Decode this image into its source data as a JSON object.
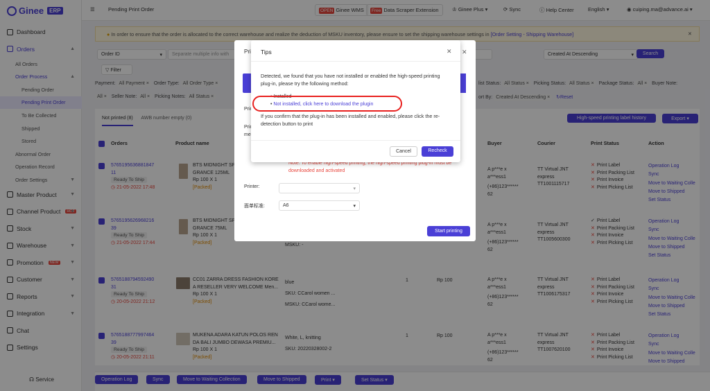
{
  "sidebar": {
    "logo": "Ginee",
    "badge": "ERP",
    "items": [
      {
        "label": "Dashboard"
      },
      {
        "label": "Orders"
      },
      {
        "label": "All Orders"
      },
      {
        "label": "Order Process"
      },
      {
        "label": "Pending Order"
      },
      {
        "label": "Pending Print Order"
      },
      {
        "label": "To Be Collected"
      },
      {
        "label": "Shipped"
      },
      {
        "label": "Stored"
      },
      {
        "label": "Abnormal Order"
      },
      {
        "label": "Operation Record"
      },
      {
        "label": "Order Settings"
      },
      {
        "label": "Master Product"
      },
      {
        "label": "Channel Product"
      },
      {
        "label": "Stock"
      },
      {
        "label": "Warehouse"
      },
      {
        "label": "Promotion"
      },
      {
        "label": "Customer"
      },
      {
        "label": "Reports"
      },
      {
        "label": "Integration"
      },
      {
        "label": "Chat"
      },
      {
        "label": "Settings"
      }
    ],
    "new_badge": "NEW",
    "service": "Service"
  },
  "topbar": {
    "page_title": "Pending Print Order",
    "open_tag": "OPEN",
    "wms": "Ginee WMS",
    "free_tag": "Free",
    "scraper": "Data Scraper Extension",
    "plus": "Ginee Plus",
    "sync": "Sync",
    "help": "Help Center",
    "lang": "English",
    "user": "cuiping.ma@advance.ai"
  },
  "notice": {
    "text": "In order to ensure that the order is allocated to the correct warehouse and realize the deduction of MSKU inventory, please ensure to set the shipping warehouse settings in",
    "link": "[Order Setting - Shipping Warehouse]"
  },
  "search": {
    "field": "Order ID",
    "placeholder": "Separate multiple info with",
    "sort": "Created At Descending",
    "button": "Search",
    "filter": "Filter"
  },
  "filters": {
    "payment_label": "Payment:",
    "payment_val": "All Payment",
    "order_type_label": "Order Type:",
    "order_type_val": "All Order Type",
    "all": "All",
    "seller_note": "Seller Note:",
    "picking_notes": "Picking Notes:",
    "list_status": "list Status:",
    "picking_status": "Picking Status:",
    "package_status": "Package Status:",
    "buyer_note": "Buyer Note:",
    "sort_by": "ort By:",
    "sort_val": "Created At Descending",
    "reset": "Reset"
  },
  "tabs": {
    "t1": "Not printed (8)",
    "t2": "AWB number empty (0)",
    "history": "High-speed printing label history",
    "export": "Export"
  },
  "table": {
    "headers": {
      "orders": "Orders",
      "product": "Product name",
      "buyer": "Buyer",
      "courier": "Courier",
      "print": "Print Status",
      "action": "Action"
    },
    "rows": [
      {
        "id1": "5765195636881847",
        "id2": "11",
        "tag": "Ready To Ship",
        "date": "21-05-2022 17:48",
        "p1": "BTS MIDNIGHT SP",
        "p2": "GRANCE 125ML",
        "p3": "Rp 100 X 1",
        "packed": "[Packed]",
        "b1": "A p***e x",
        "b2": "a***ess1",
        "b3": "(+86)123******",
        "b4": "62",
        "c1": "TT Virtual JNT",
        "c2": "express",
        "c3": "TT1001115717",
        "ps": [
          "Print Label",
          "Print Packing List",
          "Print Invoice",
          "Print Picking List"
        ],
        "acts": [
          "Operation Log",
          "Sync",
          "Move to Waiting Colle",
          "Move to Shipped",
          "Set Status"
        ]
      },
      {
        "id1": "5765195626968216",
        "id2": "39",
        "tag": "Ready To Ship",
        "date": "21-05-2022 17:44",
        "p1": "BTS MIDNIGHT SP",
        "p2": "GRANCE 75ML",
        "p3": "Rp 100 X 1",
        "packed": "[Packed]",
        "msku": "MSKU: -",
        "b1": "A p***e x",
        "b2": "a***ess1",
        "b3": "(+86)123******",
        "b4": "62",
        "c1": "TT Virtual JNT",
        "c2": "express",
        "c3": "TT1005600300",
        "ps": [
          "Print Label",
          "Print Packing List",
          "Print Invoice",
          "Print Picking List"
        ],
        "acts": [
          "Operation Log",
          "Sync",
          "Move to Waiting Colle",
          "Move to Shipped",
          "Set Status"
        ]
      },
      {
        "id1": "5765188794592490",
        "id2": "31",
        "tag": "Ready To Ship",
        "date": "20-05-2022 21:12",
        "p1": "CC01 ZARRA DRESS FASHION KORE",
        "p2": "A RESELLER VERY WELCOME Men...",
        "p3": "Rp 100 X 1",
        "packed": "[Packed]",
        "var": "blue",
        "sku": "SKU: CCarol women ...",
        "msku": "MSKU: CCarol wome...",
        "qty": "1",
        "price": "Rp 100",
        "b1": "A p***e x",
        "b2": "a***ess1",
        "b3": "(+86)123******",
        "b4": "62",
        "c1": "TT Virtual JNT",
        "c2": "express",
        "c3": "TT1006175317",
        "ps": [
          "Print Label",
          "Print Packing List",
          "Print Invoice",
          "Print Picking List"
        ],
        "acts": [
          "Operation Log",
          "Sync",
          "Move to Waiting Colle",
          "Move to Shipped",
          "Set Status"
        ]
      },
      {
        "id1": "5765188777997464",
        "id2": "39",
        "tag": "Ready To Ship",
        "date": "20-05-2022 21:11",
        "p1": "MUKENA ADARA KATUN POLOS REN",
        "p2": "DA BALI JUMBO DEWASA PREMIU...",
        "p3": "Rp 100 X 1",
        "packed": "[Packed]",
        "var": "White, L, knitting",
        "sku": "SKU: 20220328002-2",
        "qty": "1",
        "price": "Rp 100",
        "b1": "A p***e x",
        "b2": "a***ess1",
        "b3": "(+86)123******",
        "b4": "62",
        "c1": "TT Virtual JNT",
        "c2": "express",
        "c3": "TT1007620100",
        "ps": [
          "Print Label",
          "Print Packing List",
          "Print Invoice",
          "Print Picking List"
        ],
        "acts": [
          "Operation Log",
          "Sync",
          "Move to Waiting Colle",
          "Move to Shipped"
        ]
      }
    ]
  },
  "bottom": {
    "b1": "Operation Log",
    "b2": "Sync",
    "b3": "Move to Waiting Collection",
    "b4": "Move to Shipped",
    "b5": "Print",
    "b6": "Set Status"
  },
  "print_dialog": {
    "title_frag": "Pri",
    "printer_frag": "Prin",
    "mode_frag": "Prin",
    "mode_frag2": "me",
    "warning": "Note: To enable high-speed printing, the high-speed printing plug-in must be",
    "warning2": "downloaded and activated",
    "printer_label": "Printer:",
    "size_label": "面单标准:",
    "size_val": "A6",
    "start": "Start printing"
  },
  "tips": {
    "title": "Tips",
    "body1": "Detected, we found that you have not installed or enabled the high-speed printing",
    "body2": "plug-in, please try the following method:",
    "li1": "Installed",
    "li2": "Not installed, click here to download the plugin",
    "confirm1": "If you confirm that the plug-in has been installed and enabled, please click the re-",
    "confirm2": "detection button to print",
    "cancel": "Cancel",
    "recheck": "Recheck"
  },
  "colors": {
    "accent": "#4a3fd6",
    "danger": "#e8453c",
    "highlight": "#e8201e"
  }
}
